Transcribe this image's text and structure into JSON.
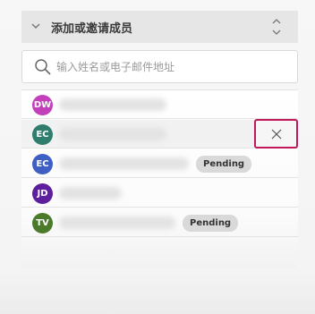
{
  "section": {
    "title": "添加或邀请成员"
  },
  "search": {
    "placeholder": "输入姓名或电子邮件地址",
    "value": ""
  },
  "members": [
    {
      "initials": "DW",
      "color": "#c43fba",
      "pending": false
    },
    {
      "initials": "EC",
      "color": "#2e7d6e",
      "pending": false
    },
    {
      "initials": "EC",
      "color": "#3f5fc4",
      "pending": true
    },
    {
      "initials": "JD",
      "color": "#5e1f9e",
      "pending": false
    },
    {
      "initials": "TV",
      "color": "#4a7a2a",
      "pending": true
    }
  ],
  "pending_label": "Pending",
  "colors": {
    "remove_highlight": "#c2185b"
  },
  "icons": {
    "collapse": "chevron-down-icon",
    "sort": "sort-icon",
    "search": "search-icon",
    "remove": "close-icon"
  }
}
